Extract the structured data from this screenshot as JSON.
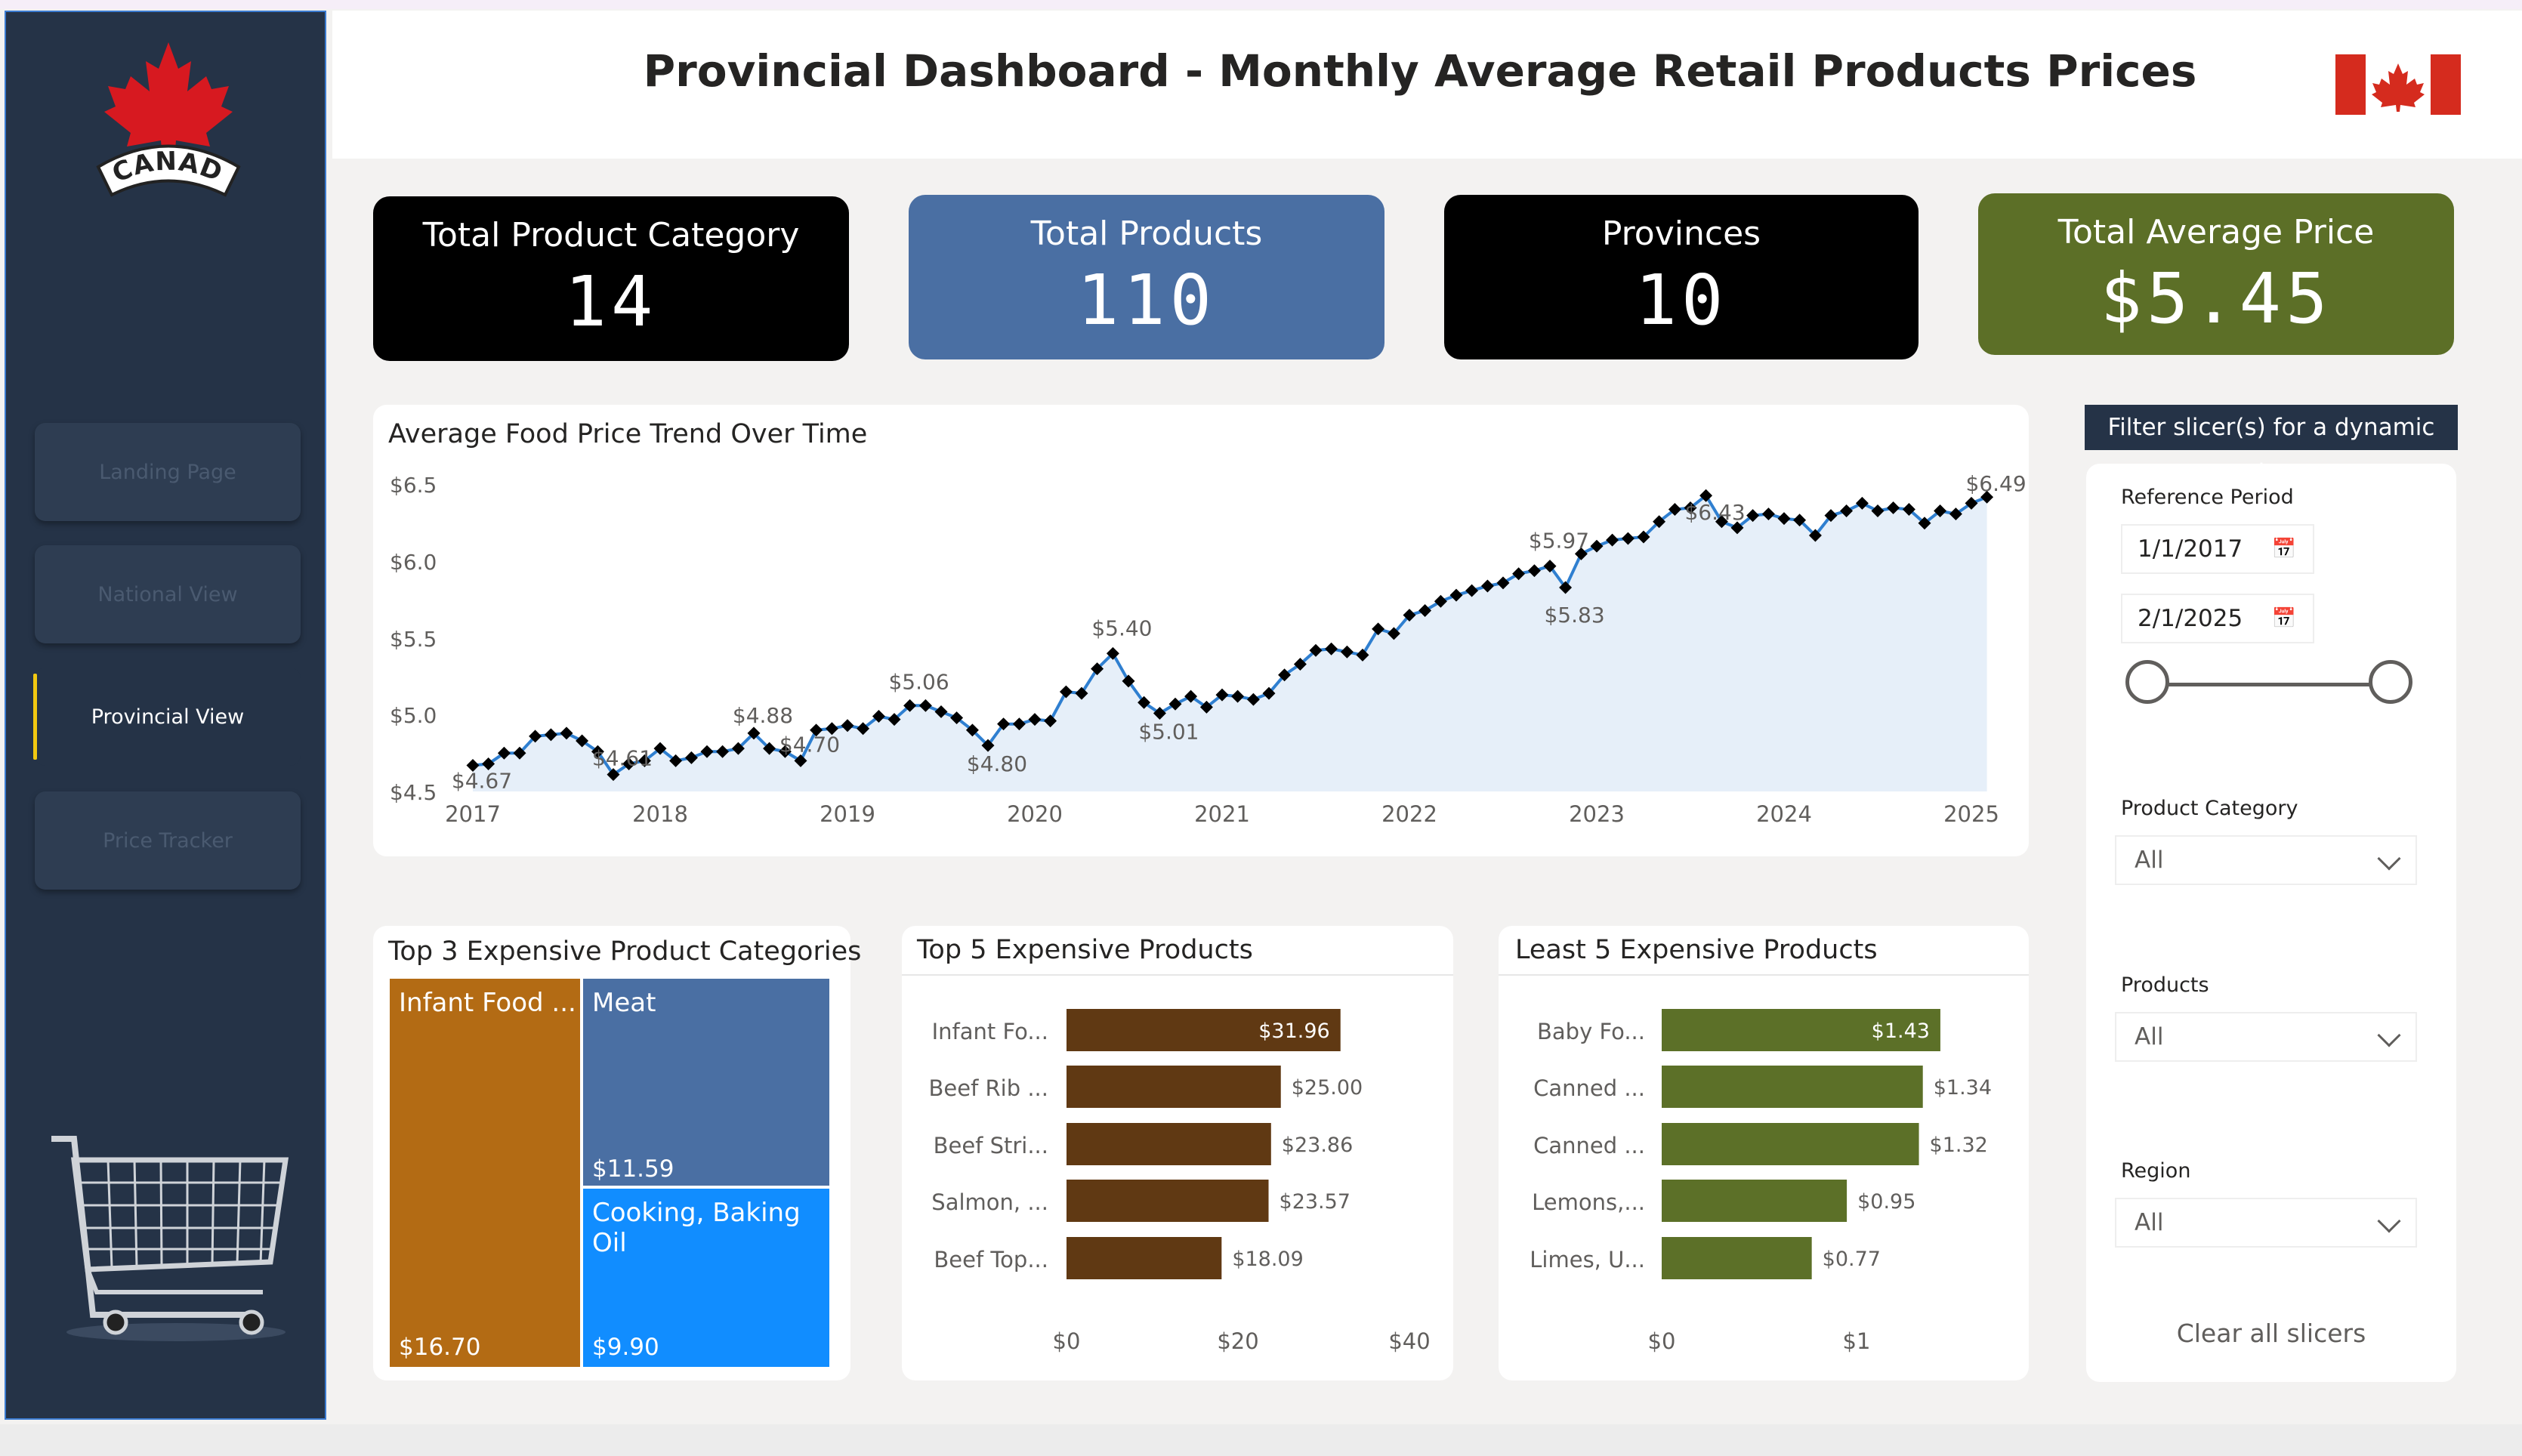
{
  "header": {
    "title": "Provincial Dashboard - Monthly Average Retail Products Prices"
  },
  "colors": {
    "sidebar": "#253347",
    "product_bar": "#603913",
    "least_bar": "#5c7028",
    "card_blue": "#4a6fa3",
    "card_green": "#5c6f27",
    "line": "#2f7fd0"
  },
  "logo": {
    "text": "CANADA"
  },
  "nav": {
    "items": [
      {
        "label": "Landing Page",
        "active": false
      },
      {
        "label": "National View",
        "active": false
      },
      {
        "label": "Provincial View",
        "active": true
      },
      {
        "label": "Price Tracker",
        "active": false
      }
    ]
  },
  "kpis": [
    {
      "label": "Total Product Category",
      "value": "14"
    },
    {
      "label": "Total Products",
      "value": "110"
    },
    {
      "label": "Provinces",
      "value": "10"
    },
    {
      "label": "Total Average Price",
      "value": "$5.45"
    }
  ],
  "trend": {
    "title": "Average Food Price Trend Over Time",
    "y_ticks": [
      "$6.5",
      "$6.0",
      "$5.5",
      "$5.0",
      "$4.5"
    ],
    "x_ticks": [
      "2017",
      "2018",
      "2019",
      "2020",
      "2021",
      "2022",
      "2023",
      "2024",
      "2025"
    ],
    "annotations": [
      "$4.67",
      "$4.61",
      "$4.88",
      "$4.70",
      "$5.06",
      "$4.80",
      "$5.40",
      "$5.01",
      "$5.97",
      "$5.83",
      "$6.43",
      "$6.49"
    ]
  },
  "treemap": {
    "title": "Top 3 Expensive Product Categories",
    "items": [
      {
        "label": "Infant Food ...",
        "value": "$16.70"
      },
      {
        "label": "Meat",
        "value": "$11.59"
      },
      {
        "label": "Cooking, Baking Oil",
        "value": "$9.90"
      }
    ]
  },
  "top5": {
    "title": "Top 5 Expensive Products",
    "items": [
      {
        "label": "Infant Fo...",
        "value_text": "$31.96"
      },
      {
        "label": "Beef Rib ...",
        "value_text": "$25.00"
      },
      {
        "label": "Beef Stri...",
        "value_text": "$23.86"
      },
      {
        "label": "Salmon, ...",
        "value_text": "$23.57"
      },
      {
        "label": "Beef Top...",
        "value_text": "$18.09"
      }
    ],
    "x_ticks": [
      "$0",
      "$20",
      "$40"
    ]
  },
  "least5": {
    "title": "Least 5 Expensive Products",
    "items": [
      {
        "label": "Baby Fo...",
        "value_text": "$1.43"
      },
      {
        "label": "Canned ...",
        "value_text": "$1.34"
      },
      {
        "label": "Canned ...",
        "value_text": "$1.32"
      },
      {
        "label": "Lemons,...",
        "value_text": "$0.95"
      },
      {
        "label": "Limes, U...",
        "value_text": "$0.77"
      }
    ],
    "x_ticks": [
      "$0",
      "$1"
    ]
  },
  "slicers": {
    "header": "Filter slicer(s) for a dynamic view",
    "reference_period": {
      "label": "Reference Period",
      "start": "1/1/2017",
      "end": "2/1/2025"
    },
    "product_category": {
      "label": "Product Category",
      "value": "All"
    },
    "products": {
      "label": "Products",
      "value": "All"
    },
    "region": {
      "label": "Region",
      "value": "All"
    },
    "clear_label": "Clear all slicers"
  },
  "chart_data": [
    {
      "type": "line",
      "title": "Average Food Price Trend Over Time",
      "xlabel": "",
      "ylabel": "",
      "ylim": [
        4.5,
        6.5
      ],
      "xlim": [
        2017,
        2025.1
      ],
      "x": [
        2017.0,
        2017.083,
        2017.167,
        2017.25,
        2017.333,
        2017.417,
        2017.5,
        2017.583,
        2017.667,
        2017.75,
        2017.833,
        2017.917,
        2018.0,
        2018.083,
        2018.167,
        2018.25,
        2018.333,
        2018.417,
        2018.5,
        2018.583,
        2018.667,
        2018.75,
        2018.833,
        2018.917,
        2019.0,
        2019.083,
        2019.167,
        2019.25,
        2019.333,
        2019.417,
        2019.5,
        2019.583,
        2019.667,
        2019.75,
        2019.833,
        2019.917,
        2020.0,
        2020.083,
        2020.167,
        2020.25,
        2020.333,
        2020.417,
        2020.5,
        2020.583,
        2020.667,
        2020.75,
        2020.833,
        2020.917,
        2021.0,
        2021.083,
        2021.167,
        2021.25,
        2021.333,
        2021.417,
        2021.5,
        2021.583,
        2021.667,
        2021.75,
        2021.833,
        2021.917,
        2022.0,
        2022.083,
        2022.167,
        2022.25,
        2022.333,
        2022.417,
        2022.5,
        2022.583,
        2022.667,
        2022.75,
        2022.833,
        2022.917,
        2023.0,
        2023.083,
        2023.167,
        2023.25,
        2023.333,
        2023.417,
        2023.5,
        2023.583,
        2023.667,
        2023.75,
        2023.833,
        2023.917,
        2024.0,
        2024.083,
        2024.167,
        2024.25,
        2024.333,
        2024.417,
        2024.5,
        2024.583,
        2024.667,
        2024.75,
        2024.833,
        2024.917,
        2025.0,
        2025.083
      ],
      "y": [
        4.67,
        4.68,
        4.75,
        4.75,
        4.86,
        4.87,
        4.88,
        4.83,
        4.76,
        4.61,
        4.68,
        4.7,
        4.78,
        4.7,
        4.72,
        4.76,
        4.76,
        4.78,
        4.88,
        4.78,
        4.76,
        4.7,
        4.9,
        4.91,
        4.93,
        4.91,
        4.99,
        4.97,
        5.06,
        5.06,
        5.02,
        4.98,
        4.9,
        4.8,
        4.94,
        4.94,
        4.97,
        4.96,
        5.15,
        5.14,
        5.3,
        5.4,
        5.22,
        5.08,
        5.01,
        5.07,
        5.12,
        5.05,
        5.13,
        5.12,
        5.1,
        5.14,
        5.26,
        5.33,
        5.42,
        5.43,
        5.41,
        5.39,
        5.56,
        5.53,
        5.65,
        5.68,
        5.74,
        5.78,
        5.81,
        5.84,
        5.86,
        5.92,
        5.94,
        5.97,
        5.83,
        6.05,
        6.1,
        6.14,
        6.15,
        6.16,
        6.26,
        6.34,
        6.35,
        6.43,
        6.26,
        6.22,
        6.3,
        6.31,
        6.28,
        6.27,
        6.17,
        6.3,
        6.33,
        6.38,
        6.33,
        6.35,
        6.34,
        6.25,
        6.33,
        6.31,
        6.38,
        6.42
      ],
      "annotations": [
        {
          "x": 2017.0,
          "y": 4.67,
          "label": "$4.67"
        },
        {
          "x": 2017.75,
          "y": 4.61,
          "label": "$4.61"
        },
        {
          "x": 2018.5,
          "y": 4.88,
          "label": "$4.88"
        },
        {
          "x": 2018.75,
          "y": 4.7,
          "label": "$4.70"
        },
        {
          "x": 2019.333,
          "y": 5.06,
          "label": "$5.06"
        },
        {
          "x": 2019.75,
          "y": 4.8,
          "label": "$4.80"
        },
        {
          "x": 2020.417,
          "y": 5.4,
          "label": "$5.40"
        },
        {
          "x": 2020.667,
          "y": 5.01,
          "label": "$5.01"
        },
        {
          "x": 2022.75,
          "y": 5.97,
          "label": "$5.97"
        },
        {
          "x": 2022.833,
          "y": 5.83,
          "label": "$5.83"
        },
        {
          "x": 2023.583,
          "y": 6.43,
          "label": "$6.43"
        },
        {
          "x": 2025.083,
          "y": 6.49,
          "label": "$6.49"
        }
      ],
      "grid": false
    },
    {
      "type": "treemap",
      "title": "Top 3 Expensive Product Categories",
      "categories": [
        "Infant Food ...",
        "Meat",
        "Cooking, Baking Oil"
      ],
      "values": [
        16.7,
        11.59,
        9.9
      ]
    },
    {
      "type": "bar",
      "orientation": "horizontal",
      "title": "Top 5 Expensive Products",
      "categories": [
        "Infant Fo...",
        "Beef Rib ...",
        "Beef Stri...",
        "Salmon, ...",
        "Beef Top..."
      ],
      "values": [
        31.96,
        25.0,
        23.86,
        23.57,
        18.09
      ],
      "xlim": [
        0,
        40
      ]
    },
    {
      "type": "bar",
      "orientation": "horizontal",
      "title": "Least 5 Expensive Products",
      "categories": [
        "Baby Fo...",
        "Canned ...",
        "Canned ...",
        "Lemons,...",
        "Limes, U..."
      ],
      "values": [
        1.43,
        1.34,
        1.32,
        0.95,
        0.77
      ],
      "xlim": [
        0,
        1.5
      ]
    }
  ]
}
